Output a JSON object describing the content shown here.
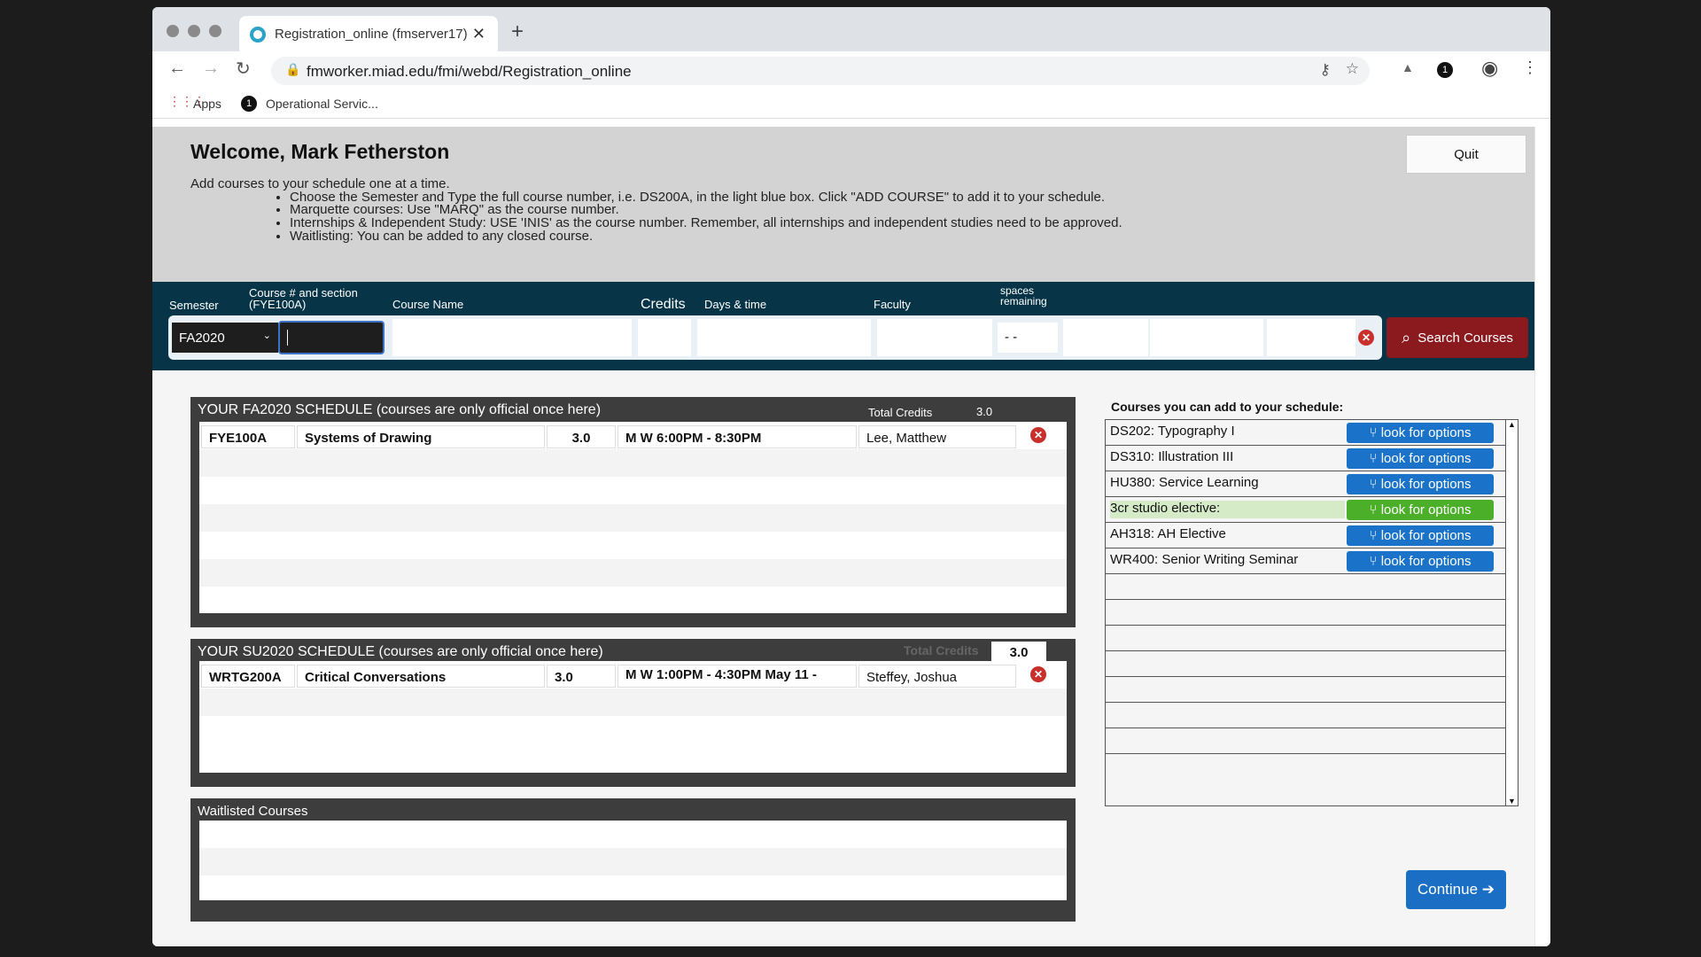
{
  "browser": {
    "tab_title": "Registration_online (fmserver17)",
    "url": "fmworker.miad.edu/fmi/webd/Registration_online",
    "bookmarks": [
      "Apps",
      "Operational Servic..."
    ]
  },
  "header": {
    "welcome": "Welcome, Mark Fetherston",
    "intro": "Add courses to your schedule one at a time.",
    "bullets": [
      "Choose the Semester and Type the full course number, i.e. DS200A, in the light blue box. Click \"ADD COURSE\" to add it to your schedule.",
      "Marquette courses: Use \"MARQ\" as the course number.",
      "Internships & Independent Study: USE 'INIS' as the course number. Remember, all internships and independent studies need to be approved.",
      "Waitlisting: You can be added to any closed course."
    ],
    "quit": "Quit"
  },
  "entry": {
    "semester_label": "Semester",
    "course_label": "Course # and section",
    "course_hint": "(FYE100A)",
    "name_label": "Course Name",
    "credits_label": "Credits",
    "days_label": "Days & time",
    "faculty_label": "Faculty",
    "spaces_label1": "spaces",
    "spaces_label2": "remaining",
    "semester_value": "FA2020",
    "spaces_value": "- -",
    "search": "Search Courses"
  },
  "fa": {
    "title": "YOUR FA2020 SCHEDULE (courses are only official once here)",
    "total_label": "Total Credits",
    "total": "3.0",
    "rows": [
      {
        "code": "FYE100A",
        "name": "Systems of Drawing",
        "credits": "3.0",
        "time": "M W  6:00PM - 8:30PM",
        "faculty": "Lee, Matthew"
      }
    ]
  },
  "su": {
    "title": "YOUR SU2020 SCHEDULE (courses are only official once here)",
    "total_label": "Total Credits",
    "total": "3.0",
    "rows": [
      {
        "code": "WRTG200A",
        "name": "Critical Conversations",
        "credits": "3.0",
        "time": "M W  1:00PM - 4:30PM   May 11 -",
        "faculty": "Steffey, Joshua"
      }
    ]
  },
  "wait": {
    "title": "Waitlisted Courses"
  },
  "addable": {
    "title": "Courses you can add to your schedule:",
    "button": "look for options",
    "items": [
      "DS202: Typography I",
      "DS310: Illustration III",
      "HU380: Service Learning",
      "3cr studio elective:",
      "AH318: AH Elective",
      "WR400: Senior Writing Seminar"
    ],
    "highlight_index": 3,
    "colors": {
      "blue": "#1a73c9",
      "green": "#4caf2a"
    }
  },
  "continue": "Continue ➔"
}
